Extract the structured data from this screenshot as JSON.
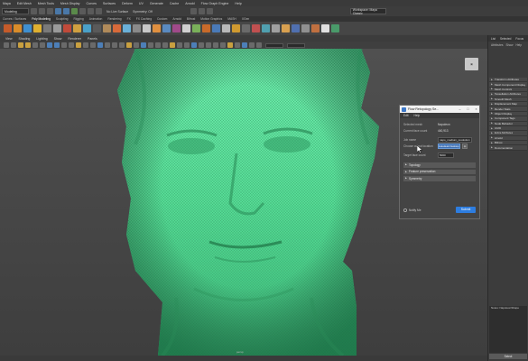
{
  "menubar": [
    "Maya",
    "Edit Mesh",
    "Mesh Tools",
    "Mesh Display",
    "Curves",
    "Surfaces",
    "Deform",
    "UV",
    "Generate",
    "Cache",
    "Arnold",
    "Flow Graph Engine",
    "Help"
  ],
  "status": {
    "mode": "Modeling",
    "symmetry": "Symmetry: Off",
    "live_surface": "Workspace: Maya Classic",
    "no_live": "No Live Surface"
  },
  "shelf_tabs": [
    "Curves / Surfaces",
    "Poly Modeling",
    "Sculpting",
    "Rigging",
    "Animation",
    "Rendering",
    "FX",
    "FX Caching",
    "Custom",
    "Arnold",
    "Bifrost",
    "Motion Graphics",
    "MASH",
    "XGen"
  ],
  "shelf_tabs_active": 1,
  "viewport_menu": [
    "View",
    "Shading",
    "Lighting",
    "Show",
    "Renderer",
    "Panels"
  ],
  "viewport_label": "persp",
  "right_panel": {
    "tabs": [
      "List",
      "Selected",
      "Focus"
    ],
    "sub": [
      "Attributes",
      "Show",
      "Help"
    ],
    "attributes": [
      "Transform Attributes",
      "Mesh Component Display",
      "Mesh Controls",
      "Tessellation Attributes",
      "Smooth Mesh",
      "Displacement Map",
      "Render Stats",
      "Object Display",
      "Component Tags",
      "Node Behavior",
      "UUID",
      "Extra Attributes",
      "Arnold",
      "Bifrost",
      "Documentation"
    ],
    "notes": "Notes: NapoleonShape",
    "select_label": "Select"
  },
  "dialog": {
    "title": "Flow Retopology Se...",
    "menu": [
      "Edit",
      "Help"
    ],
    "fields": [
      {
        "label": "Selected mesh",
        "value": "Napoleon"
      },
      {
        "label": "Current face count",
        "value": "440,913"
      }
    ],
    "job_name_label": "Job name",
    "job_name_value": "napo_medium_resolution",
    "output_label": "Choose output location",
    "output_button": "Autodesk Desktop Connector",
    "target_label": "Target face count",
    "target_value": "5000",
    "sections": [
      "Topology",
      "Feature preservation",
      "Symmetry"
    ],
    "notify_label": "Notify Me",
    "submit_label": "Submit"
  },
  "colors": {
    "mesh": "#5ee39a",
    "accent": "#2d7de0",
    "panel": "#3c3c3c"
  }
}
